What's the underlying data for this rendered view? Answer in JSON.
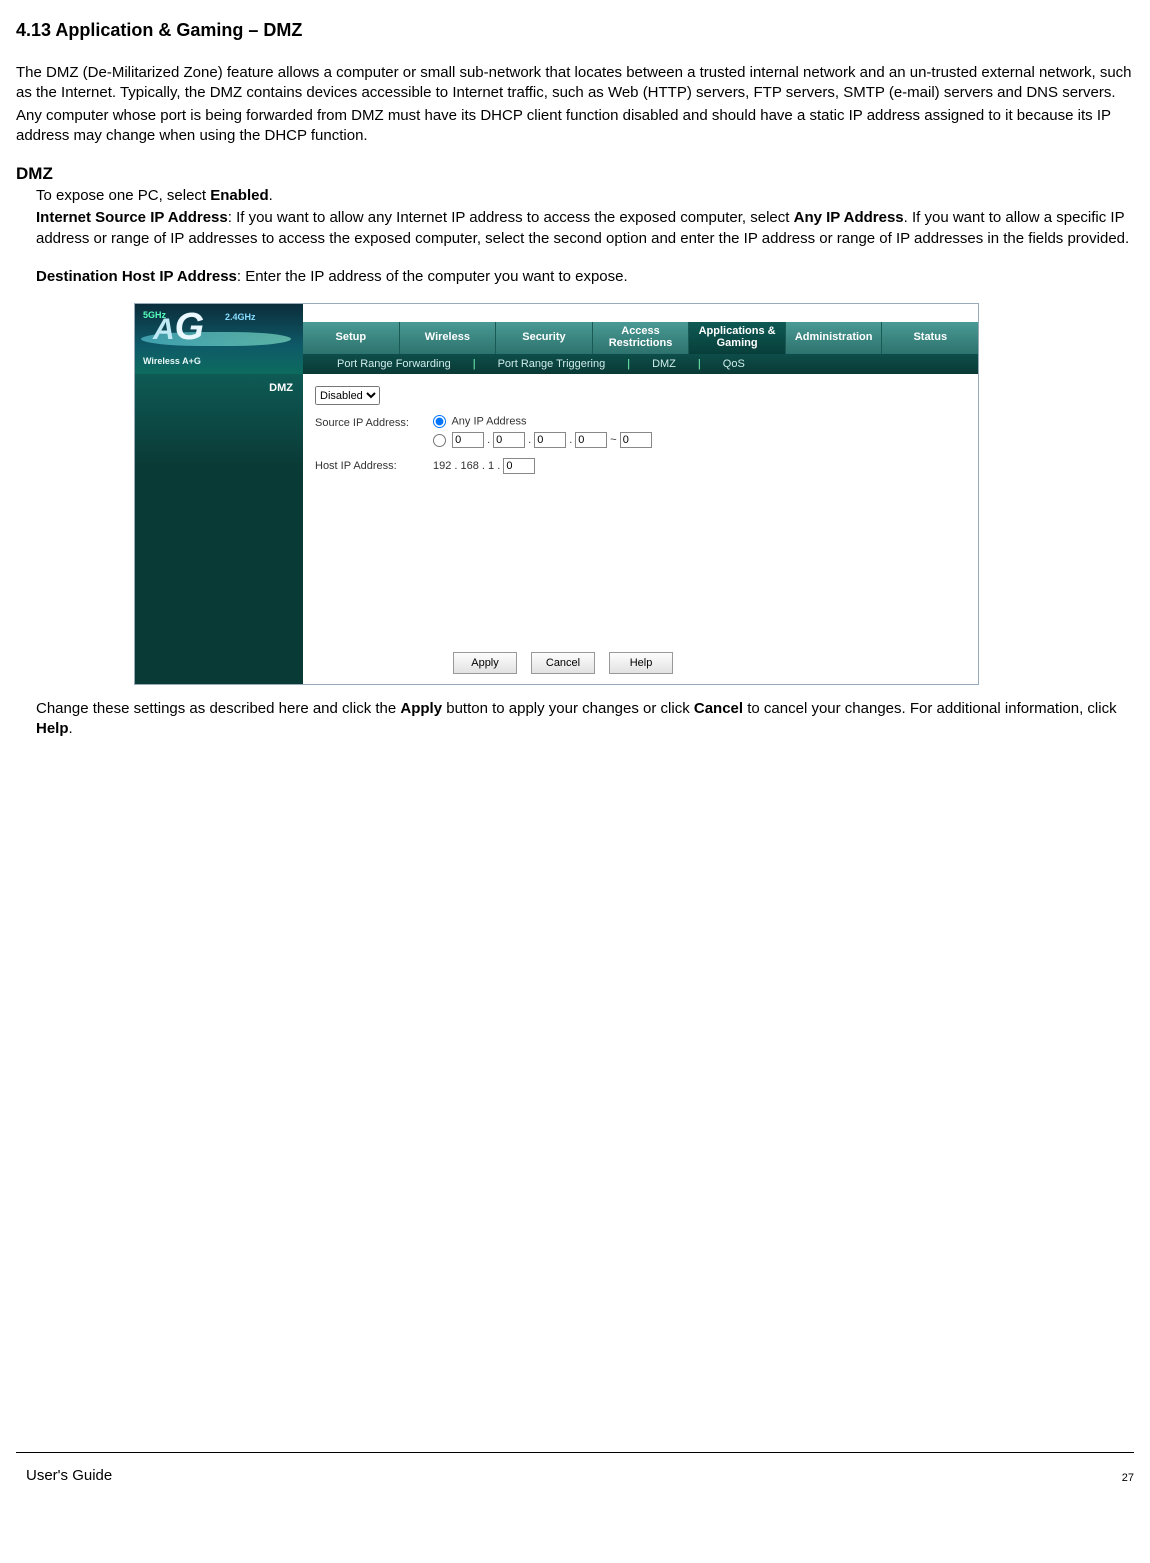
{
  "heading": "4.13 Application & Gaming – DMZ",
  "intro": {
    "p1": "The DMZ (De-Militarized Zone) feature allows a computer or small sub-network that locates between a trusted internal network and an un-trusted external network, such as the Internet. Typically, the DMZ contains devices accessible to Internet traffic, such as Web (HTTP) servers, FTP servers, SMTP (e-mail) servers and DNS servers.",
    "p2": "Any computer whose port is being forwarded from DMZ must have its DHCP client function disabled and should have a static IP address assigned to it because its IP address may change when using the DHCP function."
  },
  "subheading": "DMZ",
  "body": {
    "expose_a": "To expose one PC, select ",
    "expose_b": "Enabled",
    "expose_c": ".",
    "src_a": "Internet Source IP Address",
    "src_b": ": If you want to allow any Internet IP address to access the exposed computer, select ",
    "src_c": "Any IP Address",
    "src_d": ". If you want to allow a specific IP address or range of IP addresses to access the exposed computer, select the second option and enter the IP address or range of IP addresses in the fields provided.",
    "dest_a": "Destination Host IP Address",
    "dest_b": ": Enter the IP address of the computer you want to expose."
  },
  "router": {
    "logo_wireless": "Wireless A+G",
    "band5": "5GHz",
    "band24": "2.4GHz",
    "tabs": [
      "Setup",
      "Wireless",
      "Security",
      "Access Restrictions",
      "Applications & Gaming",
      "Administration",
      "Status"
    ],
    "subtabs": [
      "Port Range Forwarding",
      "Port Range Triggering",
      "DMZ",
      "QoS"
    ],
    "sep": "|",
    "sidebar_title": "DMZ",
    "select_value": "Disabled",
    "source_label": "Source IP Address:",
    "any_ip_label": "Any IP Address",
    "ip": {
      "a": "0",
      "b": "0",
      "c": "0",
      "d": "0",
      "e": "0"
    },
    "host_label": "Host IP Address:",
    "host_prefix": "192 . 168 . 1 .",
    "host_last": "0",
    "buttons": {
      "apply": "Apply",
      "cancel": "Cancel",
      "help": "Help"
    }
  },
  "footer_para": {
    "a": "Change these settings as described here and click the ",
    "apply": "Apply",
    "b": " button to apply your changes or click ",
    "cancel": "Cancel",
    "c": " to cancel your changes. For additional information, click ",
    "help": "Help",
    "d": "."
  },
  "footer": {
    "guide": "User's Guide",
    "page": "27"
  }
}
